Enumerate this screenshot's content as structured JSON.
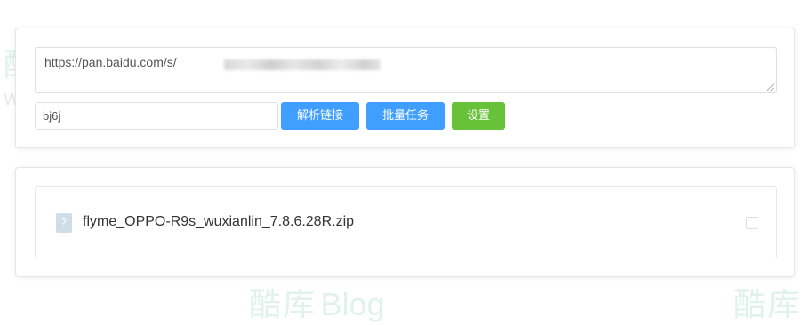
{
  "parse_form": {
    "url_value": "https://pan.baidu.com/s/",
    "password_value": "bj6j",
    "parse_button_label": "解析链接",
    "batch_button_label": "批量任务",
    "settings_button_label": "设置"
  },
  "file_list": {
    "items": [
      {
        "name": "flyme_OPPO-R9s_wuxianlin_7.8.6.28R.zip",
        "icon": "unknown-file-icon",
        "checked": false
      }
    ]
  },
  "watermark": {
    "brand_cn": "酷库",
    "brand_en": "Blog",
    "url": "www.zxki.cn"
  },
  "colors": {
    "primary": "#409eff",
    "success": "#67c23a",
    "watermark": "#1aa06a"
  }
}
